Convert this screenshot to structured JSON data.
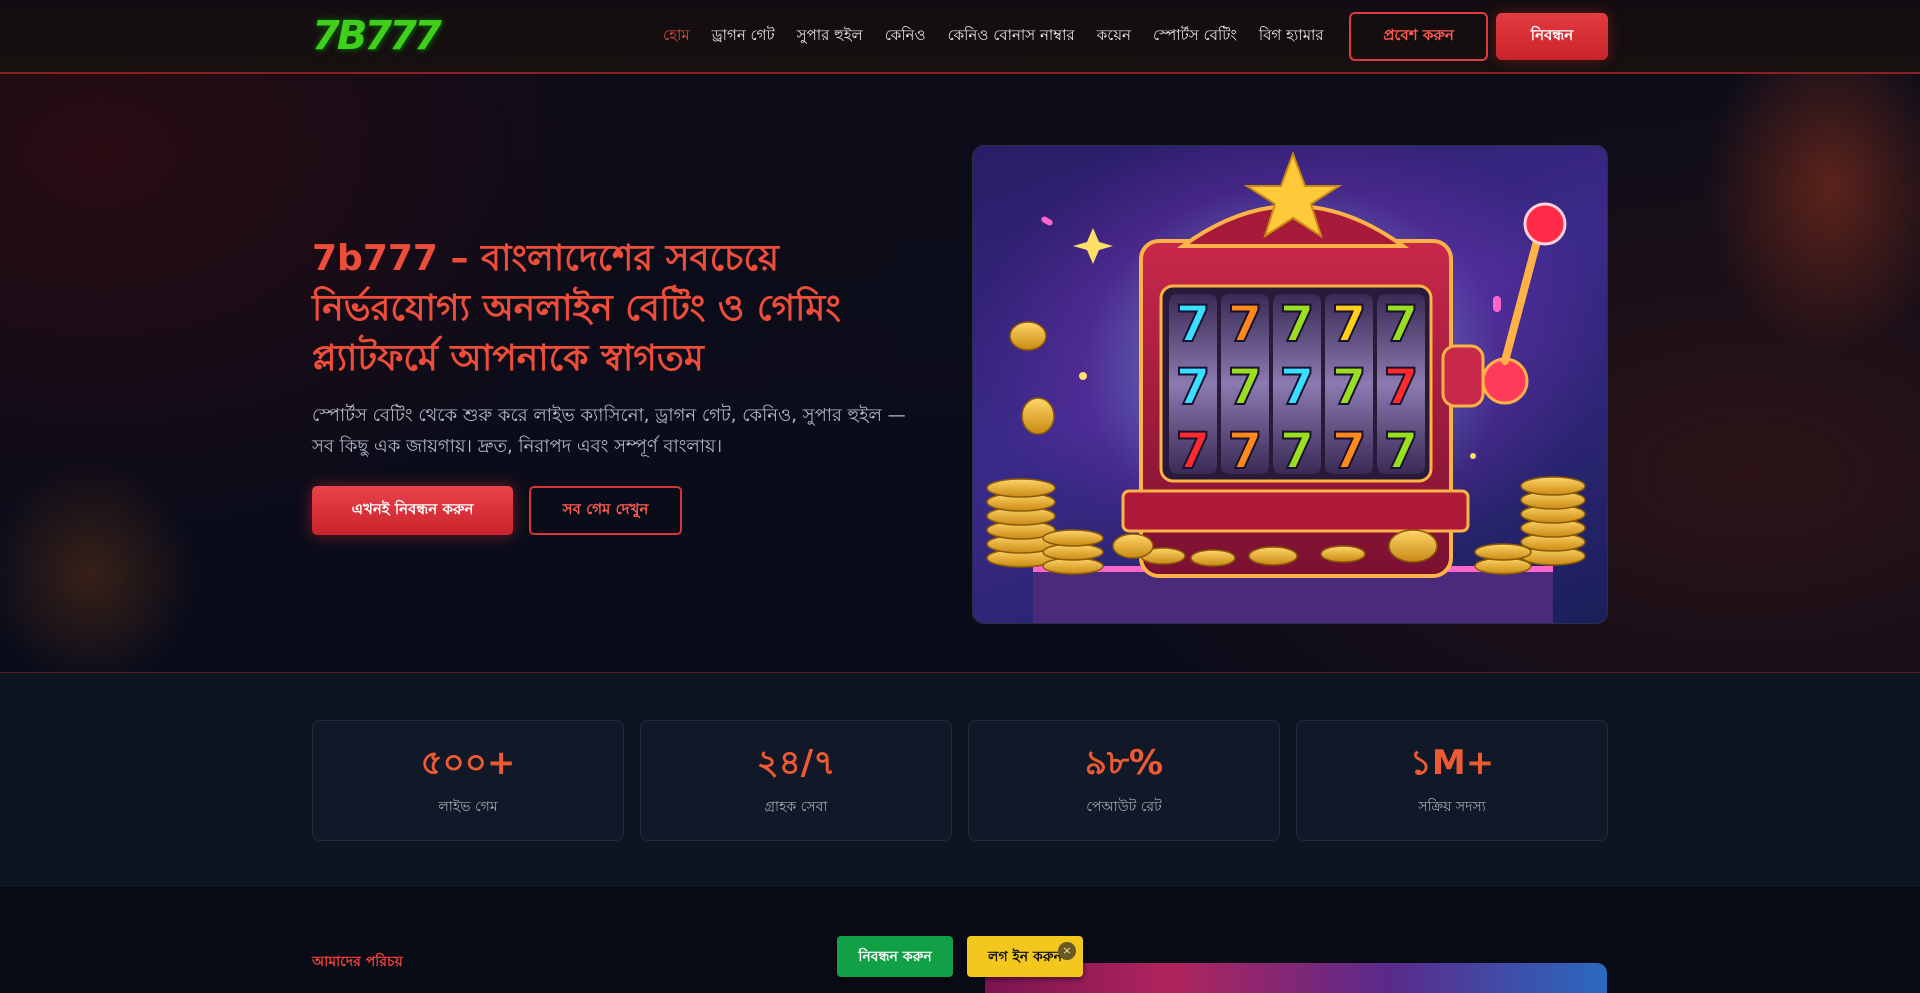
{
  "brand": {
    "logo_text": "7B777",
    "logo_color": "#3fcf1d"
  },
  "nav": {
    "items": [
      {
        "label": "হোম",
        "active": true
      },
      {
        "label": "ড্রাগন গেট"
      },
      {
        "label": "সুপার হুইল"
      },
      {
        "label": "কেনিও"
      },
      {
        "label": "কেনিও বোনাস নাম্বার"
      },
      {
        "label": "কয়েন"
      },
      {
        "label": "স্পোর্টস বেটিং"
      },
      {
        "label": "বিগ হ্যামার"
      }
    ],
    "login_label": "প্রবেশ করুন",
    "register_label": "নিবন্ধন"
  },
  "hero": {
    "title": "7b777 – বাংলাদেশের সবচেয়ে নির্ভরযোগ্য অনলাইন বেটিং ও গেমিং প্ল্যাটফর্মে আপনাকে স্বাগতম",
    "subtitle": "স্পোর্টস বেটিং থেকে শুরু করে লাইভ ক্যাসিনো, ড্রাগন গেট, কেনিও, সুপার হুইল — সব কিছু এক জায়গায়। দ্রুত, নিরাপদ এবং সম্পূর্ণ বাংলায়।",
    "register_label": "এখনই নিবন্ধন করুন",
    "games_label": "সব গেম দেখুন",
    "reel_symbols": [
      "7",
      "7",
      "7",
      "7",
      "7",
      "7",
      "7",
      "7",
      "7",
      "7",
      "7",
      "7",
      "7",
      "7",
      "7"
    ]
  },
  "stats": [
    {
      "value": "৫০০+",
      "label": "লাইভ গেম"
    },
    {
      "value": "২৪/৭",
      "label": "গ্রাহক সেবা"
    },
    {
      "value": "৯৮%",
      "label": "পেআউট রেট"
    },
    {
      "value": "১M+",
      "label": "সক্রিয় সদস্য"
    }
  ],
  "about": {
    "eyebrow": "আমাদের পরিচয়"
  },
  "floating_bar": {
    "register_label": "নিবন্ধন করুন",
    "login_label": "লগ ইন করুন",
    "close_symbol": "×"
  },
  "colors": {
    "accent": "#e84a3c",
    "stat_value": "#ee5a32",
    "float_register": "#12a046",
    "float_login": "#f2c81e"
  }
}
